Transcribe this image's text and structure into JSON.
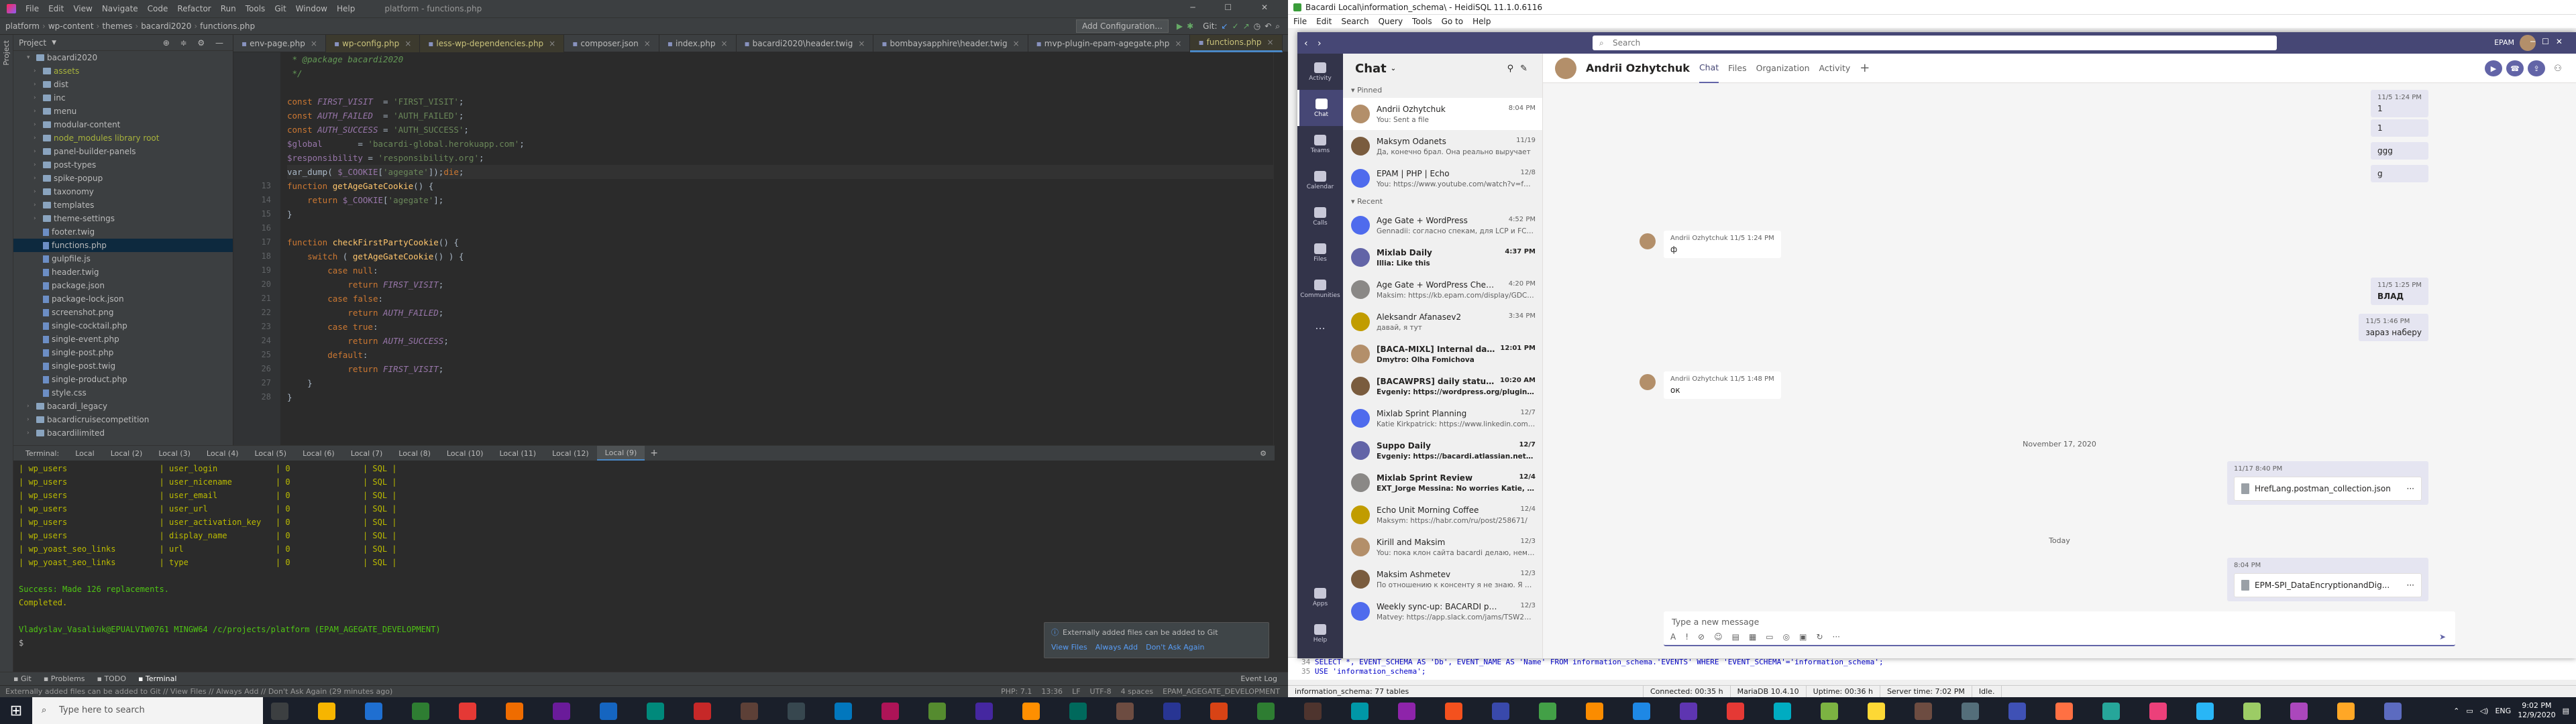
{
  "ide": {
    "menu": [
      "File",
      "Edit",
      "View",
      "Navigate",
      "Code",
      "Refactor",
      "Run",
      "Tools",
      "Git",
      "Window",
      "Help"
    ],
    "window_title": "platform - functions.php",
    "breadcrumb": [
      "platform",
      "wp-content",
      "themes",
      "bacardi2020",
      "functions.php"
    ],
    "add_config_label": "Add Configuration...",
    "git_label": "Git:",
    "project_label": "Project",
    "tree": [
      {
        "label": "bacardi2020",
        "indent": 2,
        "type": "folder",
        "open": true
      },
      {
        "label": "assets",
        "indent": 3,
        "type": "folder",
        "lime": true
      },
      {
        "label": "dist",
        "indent": 3,
        "type": "folder"
      },
      {
        "label": "inc",
        "indent": 3,
        "type": "folder"
      },
      {
        "label": "menu",
        "indent": 3,
        "type": "folder"
      },
      {
        "label": "modular-content",
        "indent": 3,
        "type": "folder"
      },
      {
        "label": "node_modules library root",
        "indent": 3,
        "type": "folder",
        "lime": true
      },
      {
        "label": "panel-builder-panels",
        "indent": 3,
        "type": "folder"
      },
      {
        "label": "post-types",
        "indent": 3,
        "type": "folder"
      },
      {
        "label": "spike-popup",
        "indent": 3,
        "type": "folder"
      },
      {
        "label": "taxonomy",
        "indent": 3,
        "type": "folder"
      },
      {
        "label": "templates",
        "indent": 3,
        "type": "folder"
      },
      {
        "label": "theme-settings",
        "indent": 3,
        "type": "folder"
      },
      {
        "label": "footer.twig",
        "indent": 3,
        "type": "file"
      },
      {
        "label": "functions.php",
        "indent": 3,
        "type": "file",
        "selected": true
      },
      {
        "label": "gulpfile.js",
        "indent": 3,
        "type": "file"
      },
      {
        "label": "header.twig",
        "indent": 3,
        "type": "file"
      },
      {
        "label": "package.json",
        "indent": 3,
        "type": "file"
      },
      {
        "label": "package-lock.json",
        "indent": 3,
        "type": "file"
      },
      {
        "label": "screenshot.png",
        "indent": 3,
        "type": "file"
      },
      {
        "label": "single-cocktail.php",
        "indent": 3,
        "type": "file"
      },
      {
        "label": "single-event.php",
        "indent": 3,
        "type": "file"
      },
      {
        "label": "single-post.php",
        "indent": 3,
        "type": "file"
      },
      {
        "label": "single-post.twig",
        "indent": 3,
        "type": "file"
      },
      {
        "label": "single-product.php",
        "indent": 3,
        "type": "file"
      },
      {
        "label": "style.css",
        "indent": 3,
        "type": "file"
      },
      {
        "label": "bacardi_legacy",
        "indent": 2,
        "type": "folder"
      },
      {
        "label": "bacardicruisecompetition",
        "indent": 2,
        "type": "folder"
      },
      {
        "label": "bacardilimited",
        "indent": 2,
        "type": "folder"
      }
    ],
    "tabs": [
      {
        "label": "env-page.php"
      },
      {
        "label": "wp-config.php",
        "yellow": true
      },
      {
        "label": "less-wp-dependencies.php",
        "yellow": true
      },
      {
        "label": "composer.json"
      },
      {
        "label": "index.php"
      },
      {
        "label": "bacardi2020\\header.twig"
      },
      {
        "label": "bombaysapphire\\header.twig"
      },
      {
        "label": "mvp-plugin-epam-agegate.php"
      },
      {
        "label": "functions.php",
        "active": true,
        "yellow": true
      },
      {
        "label": "standard_4.php"
      }
    ],
    "line_numbers": [
      "",
      "",
      "",
      "",
      "",
      "",
      "",
      "",
      "",
      "",
      "",
      "",
      "13",
      "14",
      "15",
      "16",
      "17",
      "18",
      "19",
      "20",
      "21",
      "22",
      "23",
      "24",
      "25",
      "26",
      "27",
      "28"
    ],
    "code": [
      {
        "t": " * @package bacardi2020",
        "c": "cm"
      },
      {
        "t": " */",
        "c": "cm"
      },
      {
        "t": "",
        "c": ""
      },
      {
        "t": "const FIRST_VISIT  = 'FIRST_VISIT';",
        "c": "mix1"
      },
      {
        "t": "const AUTH_FAILED  = 'AUTH_FAILED';",
        "c": "mix1"
      },
      {
        "t": "const AUTH_SUCCESS = 'AUTH_SUCCESS';",
        "c": "mix1"
      },
      {
        "t": "$global       = 'bacardi-global.herokuapp.com';",
        "c": "mix2"
      },
      {
        "t": "$responsibility = 'responsibility.org';",
        "c": "mix2"
      },
      {
        "t": "var_dump( $_COOKIE['agegate']);die;",
        "c": "mix3",
        "hl": true
      },
      {
        "t": "function getAgeGateCookie() {",
        "c": "mix4"
      },
      {
        "t": "    return $_COOKIE['agegate'];",
        "c": "mix5"
      },
      {
        "t": "}",
        "c": ""
      },
      {
        "t": "",
        "c": ""
      },
      {
        "t": "function checkFirstPartyCookie() {",
        "c": "mix6"
      },
      {
        "t": "    switch ( getAgeGateCookie() ) {",
        "c": "mix7"
      },
      {
        "t": "        case null:",
        "c": "kwl"
      },
      {
        "t": "            return FIRST_VISIT;",
        "c": "mix8"
      },
      {
        "t": "        case false:",
        "c": "kwl"
      },
      {
        "t": "            return AUTH_FAILED;",
        "c": "mix8"
      },
      {
        "t": "        case true:",
        "c": "kwl"
      },
      {
        "t": "            return AUTH_SUCCESS;",
        "c": "mix8"
      },
      {
        "t": "        default:",
        "c": "kwl"
      },
      {
        "t": "            return FIRST_VISIT;",
        "c": "mix8"
      },
      {
        "t": "    }",
        "c": ""
      },
      {
        "t": "}",
        "c": ""
      }
    ],
    "terminal_tabs": [
      "Terminal:",
      "Local",
      "Local (2)",
      "Local (3)",
      "Local (4)",
      "Local (5)",
      "Local (6)",
      "Local (7)",
      "Local (8)",
      "Local (10)",
      "Local (11)",
      "Local (12)",
      "Local (9)"
    ],
    "terminal_rows": [
      [
        "wp_users",
        "user_login",
        "0",
        "SQL"
      ],
      [
        "wp_users",
        "user_nicename",
        "0",
        "SQL"
      ],
      [
        "wp_users",
        "user_email",
        "0",
        "SQL"
      ],
      [
        "wp_users",
        "user_url",
        "0",
        "SQL"
      ],
      [
        "wp_users",
        "user_activation_key",
        "0",
        "SQL"
      ],
      [
        "wp_users",
        "display_name",
        "0",
        "SQL"
      ],
      [
        "wp_yoast_seo_links",
        "url",
        "0",
        "SQL"
      ],
      [
        "wp_yoast_seo_links",
        "type",
        "0",
        "SQL"
      ]
    ],
    "terminal_success": "Success: Made 126 replacements.",
    "terminal_completed": "Completed.",
    "terminal_prompt": "Vladyslav_Vasaliuk@EPUALVIW0761 MINGW64 /c/projects/platform (EPAM_AGEGATE_DEVELOPMENT)",
    "terminal_cursor": "$ ",
    "notification_title": "Externally added files can be added to Git",
    "notification_links": [
      "View Files",
      "Always Add",
      "Don't Ask Again"
    ],
    "bottom_tabs": [
      "Git",
      "Problems",
      "TODO",
      "Terminal"
    ],
    "event_log": "Event Log",
    "status_text": "Externally added files can be added to Git // View Files // Always Add // Don't Ask Again (29 minutes ago)",
    "status_right": [
      "PHP: 7.1",
      "13:36",
      "LF",
      "UTF-8",
      "4 spaces",
      "EPAM_AGEGATE_DEVELOPMENT"
    ]
  },
  "heidi": {
    "title": "Bacardi Local\\information_schema\\ - HeidiSQL 11.1.0.6116",
    "menu": [
      "File",
      "Edit",
      "Search",
      "Query",
      "Tools",
      "Go to",
      "Help"
    ],
    "sql_lines": [
      "SELECT *, EVENT_SCHEMA AS 'Db', EVENT_NAME AS 'Name' FROM information_schema.'EVENTS' WHERE 'EVENT_SCHEMA'='information_schema';",
      "USE 'information_schema';"
    ],
    "sql_line_nums": [
      "34",
      "35"
    ],
    "status": [
      "information_schema: 77 tables",
      "Connected: 00:35 h",
      "MariaDB 10.4.10",
      "Uptime: 00:36 h",
      "Server time: 7:02 PM",
      "Idle."
    ]
  },
  "teams": {
    "search_placeholder": "Search",
    "user_tag": "EPAM",
    "rail": [
      {
        "label": "Activity"
      },
      {
        "label": "Chat",
        "active": true
      },
      {
        "label": "Teams"
      },
      {
        "label": "Calendar"
      },
      {
        "label": "Calls"
      },
      {
        "label": "Files"
      },
      {
        "label": "Communities"
      },
      {
        "label": "..."
      }
    ],
    "rail_bottom": [
      {
        "label": "Apps"
      },
      {
        "label": "Help"
      }
    ],
    "chat_title": "Chat",
    "pinned_label": "Pinned",
    "recent_label": "Recent",
    "pinned": [
      {
        "name": "Andrii Ozhytchuk",
        "time": "8:04 PM",
        "preview": "You: Sent a file",
        "sel": true
      },
      {
        "name": "Maksym Odanets",
        "time": "11/19",
        "preview": "Да, конечно брал. Она реально выручает"
      },
      {
        "name": "EPAM | PHP | Echo",
        "time": "12/8",
        "preview": "You: https://www.youtube.com/watch?v=fmcosL..."
      }
    ],
    "recent": [
      {
        "name": "Age Gate + WordPress",
        "time": "4:52 PM",
        "preview": "Gennadii: согласно спекам, для LCP и FCP не у..."
      },
      {
        "name": "Mixlab Daily",
        "time": "4:37 PM",
        "preview": "Illia: Like this",
        "bold": true
      },
      {
        "name": "Age Gate + WordPress Checkpoint",
        "time": "4:20 PM",
        "preview": "Maksim: https://kb.epam.com/display/GDCKB/..."
      },
      {
        "name": "Aleksandr Afanasev2",
        "time": "3:34 PM",
        "preview": "давай, я тут"
      },
      {
        "name": "[BACA-MIXL] Internal daily mee...",
        "time": "12:01 PM",
        "preview": "Dmytro: Olha Fomichova",
        "bold": true
      },
      {
        "name": "[BACAWPRS] daily status call",
        "time": "10:20 AM",
        "preview": "Evgeniy: https://wordpress.org/plugins/wp...",
        "bold": true
      },
      {
        "name": "Mixlab Sprint Planning",
        "time": "12/7",
        "preview": "Katie Kirkpatrick: https://www.linkedin.com/feed/..."
      },
      {
        "name": "Suppo Daily",
        "time": "12/7",
        "preview": "Evgeniy: https://bacardi.atlassian.net/jira/ser...",
        "bold": true
      },
      {
        "name": "Mixlab Sprint Review",
        "time": "12/4",
        "preview": "EXT_Jorge Messina: No worries Katie, I don't...",
        "bold": true
      },
      {
        "name": "Echo Unit Morning Coffee",
        "time": "12/4",
        "preview": "Maksym: https://habr.com/ru/post/258671/"
      },
      {
        "name": "Kirill and Maksim",
        "time": "12/3",
        "preview": "You: пока клон сайта bacardi делаю, немного за..."
      },
      {
        "name": "Maksim Ashmetev",
        "time": "12/3",
        "preview": "По отношению к консенту я не знаю. Я не зна..."
      },
      {
        "name": "Weekly sync-up: BACARDI projects",
        "time": "12/3",
        "preview": "Matvey: https://app.slack.com/jams/TSW24VZZA..."
      }
    ],
    "conv_name": "Andrii Ozhytchuk",
    "conv_tabs": [
      "Chat",
      "Files",
      "Organization",
      "Activity"
    ],
    "out_top": [
      {
        "time": "11/5 1:24 PM",
        "text": "1"
      },
      {
        "time": "",
        "text": "1"
      },
      {
        "time": "",
        "text": "ggg"
      },
      {
        "time": "",
        "text": "g"
      }
    ],
    "in_msg1": {
      "name": "Andrii Ozhytchuk",
      "time": "11/5 1:24 PM",
      "text": "ф"
    },
    "out_mid1": {
      "time": "11/5 1:25 PM",
      "text": "ВЛАД"
    },
    "out_mid2": {
      "time": "11/5 1:46 PM",
      "text": "зараз наберу"
    },
    "in_msg2": {
      "name": "Andrii Ozhytchuk",
      "time": "11/5 1:48 PM",
      "text": "ок"
    },
    "date_sep1": "November 17, 2020",
    "file1": {
      "time": "11/17 8:40 PM",
      "name": "HrefLang.postman_collection.json"
    },
    "date_sep2": "Today",
    "file2": {
      "time": "8:04 PM",
      "name": "EPM-SPI_DataEncryptionandDig..."
    },
    "compose_placeholder": "Type a new message"
  },
  "taskbar": {
    "search_placeholder": "Type here to search",
    "lang": "ENG",
    "time": "9:02 PM",
    "date": "12/9/2020"
  }
}
